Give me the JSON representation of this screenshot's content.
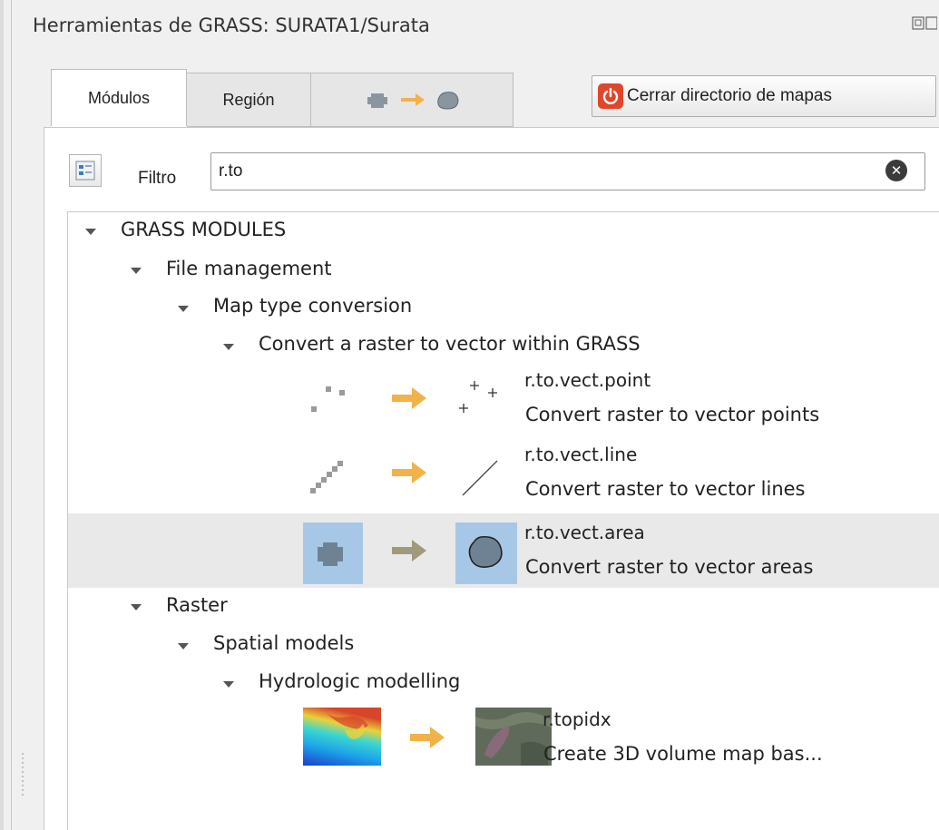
{
  "panel": {
    "title": "Herramientas de GRASS: SURATA1/Surata"
  },
  "tabs": [
    {
      "label": "Módulos"
    },
    {
      "label": "Región"
    }
  ],
  "toolbar": {
    "close_mapset_label": "Cerrar directorio de mapas"
  },
  "filter": {
    "label": "Filtro",
    "value": "r.to"
  },
  "tree": {
    "root": "GRASS MODULES",
    "file_management": "File management",
    "map_type_conversion": "Map type conversion",
    "convert_raster_vector": "Convert a raster to vector within GRASS",
    "raster": "Raster",
    "spatial_models": "Spatial models",
    "hydrologic_modelling": "Hydrologic modelling",
    "modules": [
      {
        "name": "r.to.vect.point",
        "desc": "Convert raster to vector points"
      },
      {
        "name": "r.to.vect.line",
        "desc": "Convert raster to vector lines"
      },
      {
        "name": "r.to.vect.area",
        "desc": "Convert raster to vector areas"
      },
      {
        "name": "r.topidx",
        "desc": "Create 3D volume map bas..."
      }
    ]
  },
  "colors": {
    "arrow": "#f2b24a",
    "arrow_selected": "#a09a7a",
    "selected_row": "#e9e9e9",
    "icon_highlight": "#a6c8e6",
    "close_icon": "#e0462a"
  }
}
